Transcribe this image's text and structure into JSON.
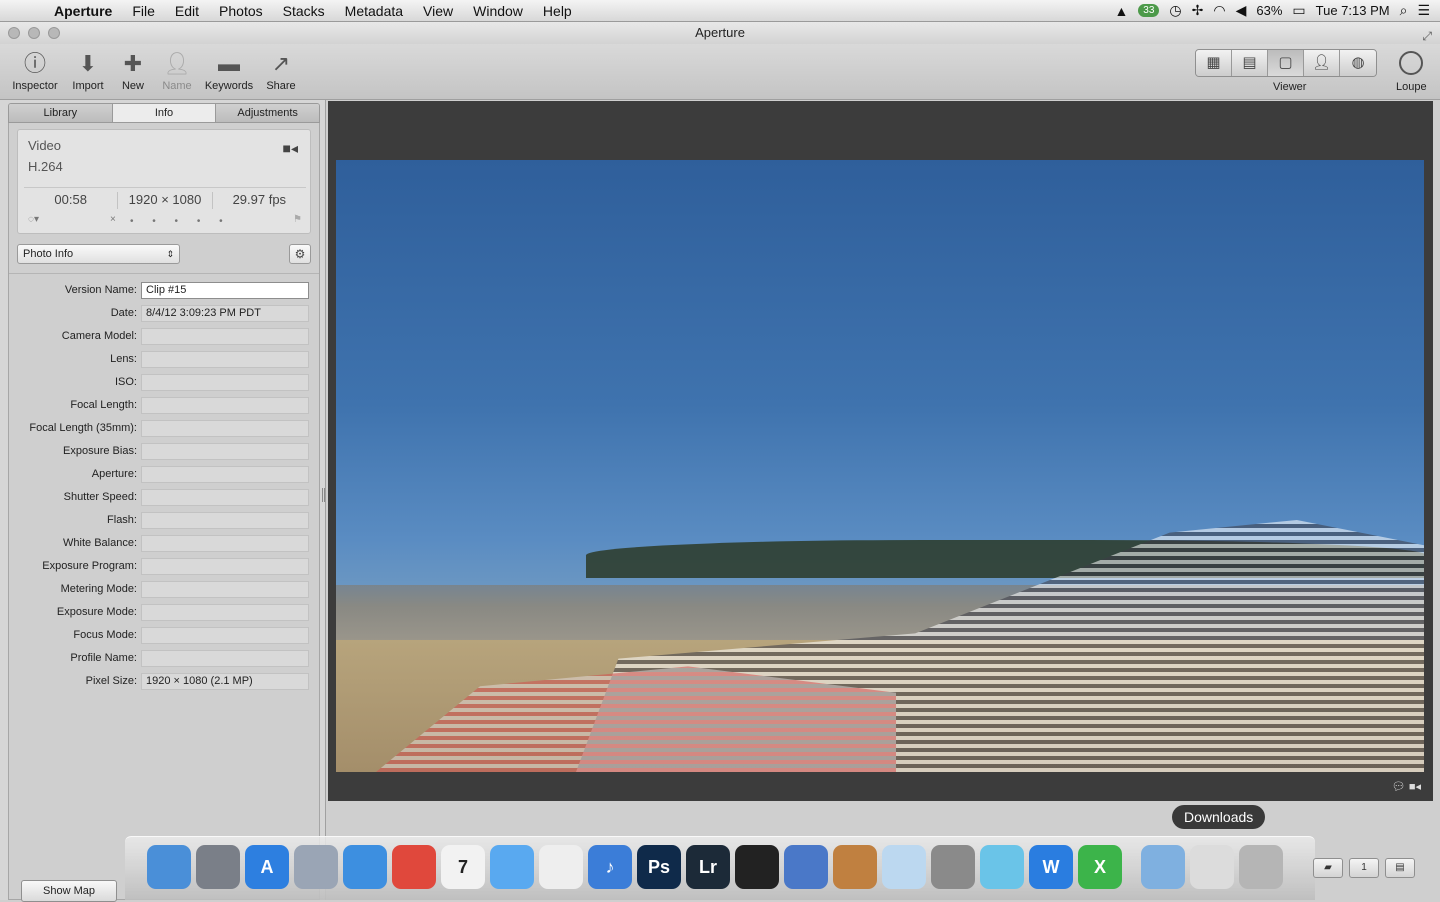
{
  "menubar": {
    "apple": "",
    "app_name": "Aperture",
    "menus": [
      "File",
      "Edit",
      "Photos",
      "Stacks",
      "Metadata",
      "View",
      "Window",
      "Help"
    ],
    "status": {
      "badge": "33",
      "battery": "63%",
      "clock": "Tue 7:13 PM"
    }
  },
  "window": {
    "title": "Aperture"
  },
  "toolbar": {
    "inspector": "Inspector",
    "import": "Import",
    "new": "New",
    "name": "Name",
    "keywords": "Keywords",
    "share": "Share",
    "viewer": "Viewer",
    "loupe": "Loupe"
  },
  "tabs": {
    "library": "Library",
    "info": "Info",
    "adjustments": "Adjustments"
  },
  "summary": {
    "kind": "Video",
    "codec": "H.264",
    "duration": "00:58",
    "dimensions": "1920 × 1080",
    "fps": "29.97 fps",
    "rating_reject": "×",
    "rating_dots": "• • • • •"
  },
  "metadata_view": {
    "selected": "Photo Info"
  },
  "fields": [
    {
      "label": "Version Name:",
      "value": "Clip #15",
      "editable": true
    },
    {
      "label": "Date:",
      "value": "8/4/12 3:09:23 PM PDT"
    },
    {
      "label": "Camera Model:",
      "value": ""
    },
    {
      "label": "Lens:",
      "value": ""
    },
    {
      "label": "ISO:",
      "value": ""
    },
    {
      "label": "Focal Length:",
      "value": ""
    },
    {
      "label": "Focal Length (35mm):",
      "value": ""
    },
    {
      "label": "Exposure Bias:",
      "value": ""
    },
    {
      "label": "Aperture:",
      "value": ""
    },
    {
      "label": "Shutter Speed:",
      "value": ""
    },
    {
      "label": "Flash:",
      "value": ""
    },
    {
      "label": "White Balance:",
      "value": ""
    },
    {
      "label": "Exposure Program:",
      "value": ""
    },
    {
      "label": "Metering Mode:",
      "value": ""
    },
    {
      "label": "Exposure Mode:",
      "value": ""
    },
    {
      "label": "Focus Mode:",
      "value": ""
    },
    {
      "label": "Profile Name:",
      "value": ""
    },
    {
      "label": "Pixel Size:",
      "value": "1920 × 1080 (2.1 MP)"
    }
  ],
  "show_map": "Show Map",
  "dock": {
    "tooltip": "Downloads",
    "items": [
      {
        "name": "finder",
        "color": "#4a8fd8",
        "glyph": ""
      },
      {
        "name": "launchpad",
        "color": "#7a7f88",
        "glyph": ""
      },
      {
        "name": "app-store",
        "color": "#2d7fe0",
        "glyph": "A"
      },
      {
        "name": "preview",
        "color": "#9aa5b5",
        "glyph": ""
      },
      {
        "name": "safari",
        "color": "#3d8fe0",
        "glyph": ""
      },
      {
        "name": "chrome",
        "color": "#e0483c",
        "glyph": ""
      },
      {
        "name": "calendar",
        "color": "#f2f2f2",
        "glyph": "7"
      },
      {
        "name": "messages",
        "color": "#59a9f0",
        "glyph": ""
      },
      {
        "name": "reminders",
        "color": "#eeeeee",
        "glyph": ""
      },
      {
        "name": "itunes",
        "color": "#3b7dd8",
        "glyph": "♪"
      },
      {
        "name": "photoshop",
        "color": "#0f2a4a",
        "glyph": "Ps"
      },
      {
        "name": "lightroom",
        "color": "#1c2a38",
        "glyph": "Lr"
      },
      {
        "name": "aperture",
        "color": "#222222",
        "glyph": ""
      },
      {
        "name": "xcode",
        "color": "#4a78c8",
        "glyph": ""
      },
      {
        "name": "image-capture",
        "color": "#c08040",
        "glyph": ""
      },
      {
        "name": "sketch",
        "color": "#bcd8f0",
        "glyph": ""
      },
      {
        "name": "system-preferences",
        "color": "#8a8a8a",
        "glyph": ""
      },
      {
        "name": "cleaner",
        "color": "#6ac4e8",
        "glyph": ""
      },
      {
        "name": "word",
        "color": "#2a7de0",
        "glyph": "W"
      },
      {
        "name": "excel",
        "color": "#3cb44a",
        "glyph": "X"
      },
      {
        "name": "applications-folder",
        "color": "#7fb0e0",
        "glyph": ""
      },
      {
        "name": "downloads-stack",
        "color": "#dcdcdc",
        "glyph": ""
      },
      {
        "name": "trash",
        "color": "#b5b5b5",
        "glyph": ""
      }
    ]
  }
}
